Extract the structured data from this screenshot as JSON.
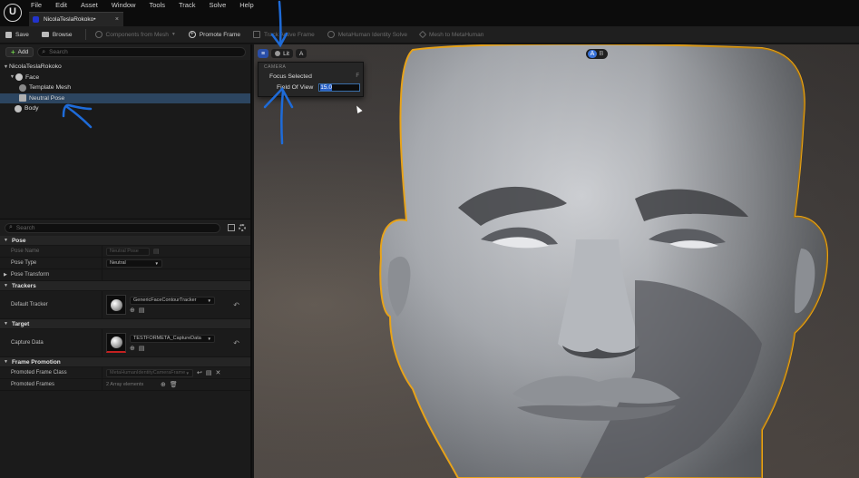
{
  "app": {
    "logo_glyph": "U"
  },
  "menu": [
    "File",
    "Edit",
    "Asset",
    "Window",
    "Tools",
    "Track",
    "Solve",
    "Help"
  ],
  "doc_tab": {
    "title": "NicolaTeslaRokoko•",
    "close": "×"
  },
  "toolbar": {
    "save": "Save",
    "browse": "Browse",
    "components_from_mesh": "Components from Mesh",
    "promote_frame": "Promote Frame",
    "track_active_frame": "Track Active Frame",
    "metahuman_identity_solve": "MetaHuman Identity Solve",
    "mesh_to_metahuman": "Mesh to MetaHuman"
  },
  "outliner": {
    "add_label": "Add",
    "search_placeholder": "Search",
    "tree": [
      {
        "label": "NicolaTeslaRokoko",
        "indent": 0,
        "arrow": "▼",
        "selected": false
      },
      {
        "label": "Face",
        "indent": 1,
        "arrow": "▼",
        "selected": false
      },
      {
        "label": "Template Mesh",
        "indent": 2,
        "arrow": "",
        "selected": false
      },
      {
        "label": "Neutral Pose",
        "indent": 2,
        "arrow": "",
        "selected": true
      },
      {
        "label": "Body",
        "indent": 1,
        "arrow": "",
        "selected": false
      }
    ]
  },
  "details": {
    "search_placeholder": "Search",
    "pose": {
      "header": "Pose",
      "pose_name_label": "Pose Name",
      "pose_name_value": "Neutral Pose",
      "pose_type_label": "Pose Type",
      "pose_type_value": "Neutral",
      "pose_transform_label": "Pose Transform"
    },
    "trackers": {
      "header": "Trackers",
      "default_tracker_label": "Default Tracker",
      "default_tracker_value": "GenericFaceContourTracker"
    },
    "target": {
      "header": "Target",
      "capture_data_label": "Capture Data",
      "capture_data_value": "TESTFORMETA_CaptureData"
    },
    "frame_promotion": {
      "header": "Frame Promotion",
      "promoted_frame_class_label": "Promoted Frame Class",
      "promoted_frame_class_value": "MetaHumanIdentityCameraFrame",
      "promoted_frames_label": "Promoted Frames",
      "promoted_frames_value": "2 Array elements"
    }
  },
  "viewport": {
    "lit_label": "Lit",
    "a_label": "A",
    "ab_toggle": [
      "A",
      "B"
    ],
    "camera_popup": {
      "header": "CAMERA",
      "focus_selected": "Focus Selected",
      "focus_shortcut": "F",
      "field_of_view_label": "Field Of View",
      "field_of_view_value": "15.0"
    }
  },
  "colors": {
    "accent_blue": "#2a62c8",
    "selection_outline": "#e8a319",
    "annotation_blue": "#1e6bd8"
  }
}
